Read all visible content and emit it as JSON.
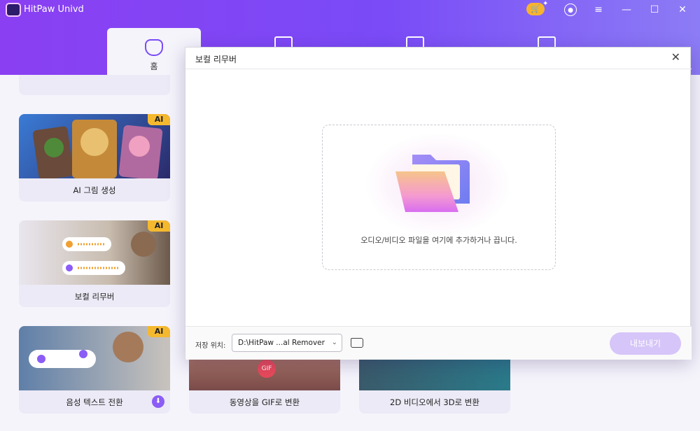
{
  "app": {
    "title": "HitPaw Univd"
  },
  "header": {
    "home_tab_label": "홈"
  },
  "cards": [
    {
      "label": "AI 그림 생성",
      "badge": "AI"
    },
    {
      "label": "보컬 리무버",
      "badge": "AI"
    },
    {
      "label": "음성 텍스트 전환",
      "badge": "AI"
    },
    {
      "label": "동영상을 GIF로 변환",
      "badge": "GIF"
    },
    {
      "label": "2D 비디오에서 3D로 변환"
    }
  ],
  "dialog": {
    "title": "보컬 리무버",
    "drop_text": "오디오/비디오 파일을 여기에 추가하거나 끕니다.",
    "save_label": "저장 위치:",
    "save_path": "D:\\HitPaw ...al Remover",
    "export_label": "내보내기"
  },
  "colors": {
    "accent": "#7a4bf7",
    "badge": "#f5b92f",
    "export_disabled": "#d6c5f8"
  },
  "icons": [
    "cart-icon",
    "user-icon",
    "menu-icon",
    "minimize-icon",
    "maximize-icon",
    "close-icon",
    "folder-icon",
    "download-icon"
  ]
}
